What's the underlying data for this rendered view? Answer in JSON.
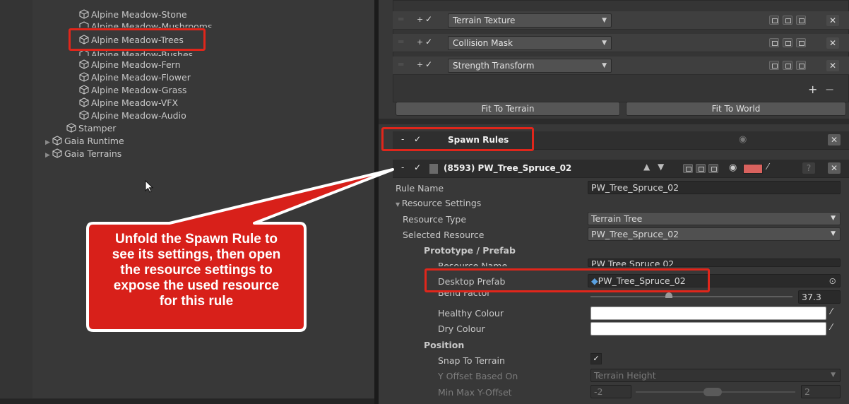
{
  "hierarchy": {
    "items": [
      {
        "label": "Alpine Meadow-Stone"
      },
      {
        "label": "Alpine Meadow-Mushrooms"
      },
      {
        "label": "Alpine Meadow-Trees"
      },
      {
        "label": "Alpine Meadow-Bushes"
      },
      {
        "label": "Alpine Meadow-Fern"
      },
      {
        "label": "Alpine Meadow-Flower"
      },
      {
        "label": "Alpine Meadow-Grass"
      },
      {
        "label": "Alpine Meadow-VFX"
      },
      {
        "label": "Alpine Meadow-Audio"
      },
      {
        "label": "Stamper"
      },
      {
        "label": "Gaia Runtime"
      },
      {
        "label": "Gaia Terrains"
      }
    ]
  },
  "mask_layers": [
    {
      "type": "Terrain Texture"
    },
    {
      "type": "Collision Mask"
    },
    {
      "type": "Strength Transform"
    }
  ],
  "list_controls": {
    "add": "+",
    "remove": "−"
  },
  "buttons": {
    "fit_to_terrain": "Fit To Terrain",
    "fit_to_world": "Fit To World"
  },
  "spawn_rules": {
    "label": "Spawn Rules"
  },
  "rule": {
    "title": "(8593) PW_Tree_Spruce_02",
    "color": "#d9625e",
    "rule_name_label": "Rule Name",
    "rule_name_value": "PW_Tree_Spruce_02",
    "resource_settings_label": "Resource Settings",
    "resource_type_label": "Resource Type",
    "resource_type_value": "Terrain Tree",
    "selected_resource_label": "Selected Resource",
    "selected_resource_value": "PW_Tree_Spruce_02",
    "prototype_label": "Prototype / Prefab",
    "resource_name_label": "Resource Name",
    "resource_name_value": "PW Tree Spruce 02",
    "desktop_prefab_label": "Desktop Prefab",
    "desktop_prefab_value": "PW_Tree_Spruce_02",
    "bend_factor_label": "Bend Factor",
    "bend_factor_value": "37.3",
    "healthy_colour_label": "Healthy Colour",
    "dry_colour_label": "Dry Colour",
    "position_label": "Position",
    "snap_label": "Snap To Terrain",
    "y_offset_based_on_label": "Y Offset Based On",
    "y_offset_based_on_value": "Terrain Height",
    "min_max_label": "Min Max Y-Offset",
    "min_value": "-2",
    "max_value": "2"
  },
  "callout": {
    "lines": [
      "Unfold the Spawn Rule to",
      "see its settings, then open",
      "the resource settings to",
      "expose the used resource",
      "for this rule"
    ]
  },
  "colors": {
    "highlight": "#e0261b",
    "callout_fill": "#d8201a"
  }
}
